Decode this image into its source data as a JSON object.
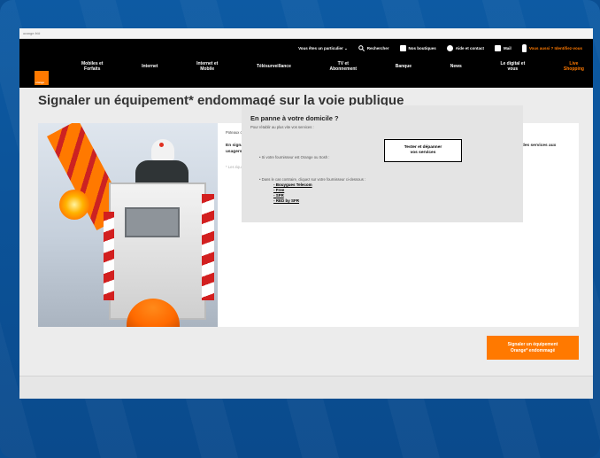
{
  "browser": {
    "url": "orange.fr/#"
  },
  "header": {
    "utility": [
      {
        "label": "Vous êtes un particulier ⌄",
        "icon": "none"
      },
      {
        "label": "Rechercher",
        "icon": "search-icon"
      },
      {
        "label": "Nos boutiques",
        "icon": "store-icon"
      },
      {
        "label": "Aide et contact",
        "icon": "help-icon"
      },
      {
        "label": "Mail",
        "icon": "mail-icon"
      },
      {
        "label": "Vous aussi ? Identifiez-vous",
        "icon": "user-icon"
      }
    ],
    "logo_text": "orange",
    "menu": [
      {
        "label": "Mobiles et\nForfaits"
      },
      {
        "label": "Internet"
      },
      {
        "label": "Internet et\nMobile"
      },
      {
        "label": "Télésurveillance"
      },
      {
        "label": "TV et\nAbonnement"
      },
      {
        "label": "Banque"
      },
      {
        "label": "News"
      },
      {
        "label": "Le digital et\nvous"
      },
      {
        "label": "Live\nShopping"
      }
    ]
  },
  "page": {
    "title": "Signaler un équipement* endommagé sur la voie publique",
    "intro": "Poteaux cassés ou penchés, câbles décrochés ou arrachés, armoires ouvertes ou détériorées.",
    "lead": "En signalant vos anomalies via notre site, vous permettez à Orange® de réparer rapidement ses installations et de maintenir ainsi la bonne qualité des services aux usagers.",
    "note": "* Les équipements Orange sont dans la voie publique France Telecom"
  },
  "panel": {
    "title": "En panne à votre domicile ?",
    "subtitle": "Pour rétablir au plus vite vos services :",
    "case1": "• Si votre fournisseur est Orange ou Sosh :",
    "test_button": "Tester et dépanner\nvos services",
    "case2": "• Dans le cas contraire, cliquez sur votre fournisseur ci-dessous :",
    "providers": [
      "- Bouygues Telecom",
      "- Free",
      "- SFR",
      "- RED by SFR"
    ]
  },
  "cta_button": "Signaler un équipement\nOrange* endommagé",
  "colors": {
    "accent": "#ff7900",
    "nav_bg": "#000000",
    "frame": "#0b4f93"
  }
}
